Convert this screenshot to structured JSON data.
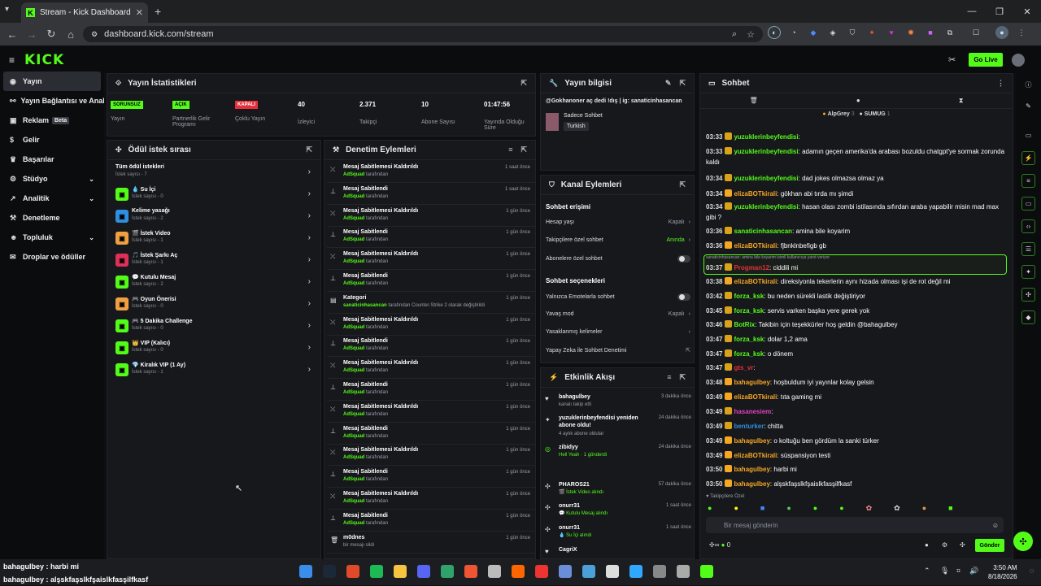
{
  "browser": {
    "tab_title": "Stream - Kick Dashboard",
    "url": "dashboard.kick.com/stream"
  },
  "header": {
    "logo": "KICK",
    "go_live": "Go Live"
  },
  "nav": [
    {
      "label": "Yayın",
      "icon": "broadcast-icon"
    },
    {
      "label": "Yayın Bağlantısı ve Anahtarı",
      "icon": "link-icon"
    },
    {
      "label": "Reklam",
      "icon": "megaphone-icon",
      "badge": "Beta"
    },
    {
      "label": "Gelir",
      "icon": "dollar-icon"
    },
    {
      "label": "Başarılar",
      "icon": "trophy-icon"
    },
    {
      "label": "Stüdyo",
      "icon": "gear-icon"
    },
    {
      "label": "Analitik",
      "icon": "chart-icon"
    },
    {
      "label": "Denetleme",
      "icon": "gavel-icon"
    },
    {
      "label": "Topluluk",
      "icon": "people-icon"
    },
    {
      "label": "Droplar ve ödüller",
      "icon": "gift-icon"
    }
  ],
  "stats": {
    "title": "Yayın İstatistikleri",
    "items": [
      {
        "badge": "SORUNSUZ",
        "label": "Yayın",
        "color": "#53fc18"
      },
      {
        "badge": "AÇIK",
        "label": "Partnerlik Gelir Programı",
        "color": "#53fc18"
      },
      {
        "badge": "KAPALI",
        "label": "Çoklu Yayın",
        "color": "#e5303c"
      },
      {
        "value": "40",
        "label": "İzleyici"
      },
      {
        "value": "2.371",
        "label": "Takipçi"
      },
      {
        "value": "10",
        "label": "Abone Sayısı"
      },
      {
        "value": "01:47:56",
        "label": "Yayında Olduğu Süre"
      }
    ]
  },
  "stream_info": {
    "title": "Yayın bilgisi",
    "stream_title": "@Gokhanoner aç dedi !dış | ig: sanaticinhasancan",
    "category": "Sadece Sohbet",
    "tag": "Turkish"
  },
  "rewards": {
    "title": "Ödül istek sırası",
    "items": [
      {
        "name": "Tüm ödül istekleri",
        "count": "İstek sayısı - 7"
      },
      {
        "name": "💧 Su İçi",
        "count": "İstek sayısı - 0",
        "color": "#53fc18"
      },
      {
        "name": "Kelime yasağı",
        "count": "İstek sayısı - 2",
        "color": "#2f8fe0"
      },
      {
        "name": "🎬 İstek Video",
        "count": "İstek sayısı - 1",
        "color": "#f0a040"
      },
      {
        "name": "🎵 İstek Şarkı Aç",
        "count": "İstek sayısı - 1",
        "color": "#e0305a"
      },
      {
        "name": "💬 Kutulu Mesaj",
        "count": "İstek sayısı - 2",
        "color": "#53fc18"
      },
      {
        "name": "🎮 Oyun Önerisi",
        "count": "İstek sayısı - 0",
        "color": "#f0a040"
      },
      {
        "name": "🎮 5 Dakika Challenge",
        "count": "İstek sayısı - 0",
        "color": "#53fc18"
      },
      {
        "name": "👑 VIP (Kalıcı)",
        "count": "İstek sayısı - 0",
        "color": "#53fc18"
      },
      {
        "name": "💎 Kiralık VIP (1 Ay)",
        "count": "İstek sayısı - 1",
        "color": "#53fc18"
      }
    ]
  },
  "modlog": {
    "title": "Denetim Eylemleri",
    "items": [
      {
        "action": "Mesaj Sabitlemesi Kaldırıldı",
        "by": "AdSquad",
        "suffix": "tarafından",
        "when": "1 saat önce",
        "icon": "unpin-icon"
      },
      {
        "action": "Mesaj Sabitlendi",
        "by": "AdSquad",
        "suffix": "tarafından",
        "when": "1 saat önce",
        "icon": "pin-icon"
      },
      {
        "action": "Mesaj Sabitlemesi Kaldırıldı",
        "by": "AdSquad",
        "suffix": "tarafından",
        "when": "1 gün önce",
        "icon": "unpin-icon"
      },
      {
        "action": "Mesaj Sabitlendi",
        "by": "AdSquad",
        "suffix": "tarafından",
        "when": "1 gün önce",
        "icon": "pin-icon"
      },
      {
        "action": "Mesaj Sabitlemesi Kaldırıldı",
        "by": "AdSquad",
        "suffix": "tarafından",
        "when": "1 gün önce",
        "icon": "unpin-icon"
      },
      {
        "action": "Mesaj Sabitlendi",
        "by": "AdSquad",
        "suffix": "tarafından",
        "when": "1 gün önce",
        "icon": "pin-icon"
      },
      {
        "action": "Kategori",
        "by": "sanaticinhasancan",
        "suffix": "tarafından Counter-Strike 2 olarak değiştirildi",
        "when": "1 gün önce",
        "icon": "category-icon"
      },
      {
        "action": "Mesaj Sabitlemesi Kaldırıldı",
        "by": "AdSquad",
        "suffix": "tarafından",
        "when": "1 gün önce",
        "icon": "unpin-icon"
      },
      {
        "action": "Mesaj Sabitlendi",
        "by": "AdSquad",
        "suffix": "tarafından",
        "when": "1 gün önce",
        "icon": "pin-icon"
      },
      {
        "action": "Mesaj Sabitlemesi Kaldırıldı",
        "by": "AdSquad",
        "suffix": "tarafından",
        "when": "1 gün önce",
        "icon": "unpin-icon"
      },
      {
        "action": "Mesaj Sabitlendi",
        "by": "AdSquad",
        "suffix": "tarafından",
        "when": "1 gün önce",
        "icon": "pin-icon"
      },
      {
        "action": "Mesaj Sabitlemesi Kaldırıldı",
        "by": "AdSquad",
        "suffix": "tarafından",
        "when": "1 gün önce",
        "icon": "unpin-icon"
      },
      {
        "action": "Mesaj Sabitlendi",
        "by": "AdSquad",
        "suffix": "tarafından",
        "when": "1 gün önce",
        "icon": "pin-icon"
      },
      {
        "action": "Mesaj Sabitlemesi Kaldırıldı",
        "by": "AdSquad",
        "suffix": "tarafından",
        "when": "1 gün önce",
        "icon": "unpin-icon"
      },
      {
        "action": "Mesaj Sabitlendi",
        "by": "AdSquad",
        "suffix": "tarafından",
        "when": "1 gün önce",
        "icon": "pin-icon"
      },
      {
        "action": "Mesaj Sabitlemesi Kaldırıldı",
        "by": "AdSquad",
        "suffix": "tarafından",
        "when": "1 gün önce",
        "icon": "unpin-icon"
      },
      {
        "action": "Mesaj Sabitlendi",
        "by": "AdSquad",
        "suffix": "tarafından",
        "when": "1 gün önce",
        "icon": "pin-icon"
      },
      {
        "action": "m0dnes",
        "by": "",
        "suffix": "bir mesajı sildi",
        "when": "1 gün önce",
        "icon": "trash-icon"
      }
    ]
  },
  "channel": {
    "title": "Kanal Eylemleri",
    "chat_access": "Sohbet erişimi",
    "age": "Hesap yaşı",
    "age_val": "Kapalı",
    "followers": "Takipçilere özel sohbet",
    "followers_val": "Anında",
    "subs": "Abonelere özel sohbet",
    "chat_opts": "Sohbet seçenekleri",
    "emotes": "Yalnızca Emotelarla sohbet",
    "slow": "Yavaş mod",
    "slow_val": "Kapalı",
    "banned": "Yasaklanmış kelimeler",
    "ai": "Yapay Zeka ile Sohbet Denetimi"
  },
  "activity": {
    "title": "Etkinlik Akışı",
    "items": [
      {
        "name": "bahagulbey",
        "desc": "kanalı takip etti",
        "when": "3 dakika önce",
        "icon": "heart-icon"
      },
      {
        "name": "yuzuklerinbeyfendisi yeniden abone oldu!",
        "desc": "4 aylık abone oldular",
        "when": "24 dakika önce",
        "icon": "star-icon"
      },
      {
        "name": "zibidyy",
        "desc": "Hell Yeah · 1 gönderdi",
        "when": "24 dakika önce",
        "icon": "kicks-icon"
      },
      {
        "name": "PHAROS21",
        "desc": "🎬 İstek Video alındı",
        "when": "57 dakika önce",
        "icon": "reward-icon"
      },
      {
        "name": "onurr31",
        "desc": "💬 Kutulu Mesaj alındı",
        "when": "1 saat önce",
        "icon": "reward-icon"
      },
      {
        "name": "onurr31",
        "desc": "💧 Su İçi alındı",
        "when": "1 saat önce",
        "icon": "reward-icon"
      },
      {
        "name": "CagriX",
        "desc": "",
        "when": "",
        "icon": "heart-icon"
      }
    ]
  },
  "chat": {
    "title": "Sohbet",
    "top_user1": "AlpGrey",
    "top_num1": "3",
    "top_user2": "SUMUG",
    "top_num2": "1",
    "messages": [
      {
        "time": "03:33",
        "user": "yuzuklerinbeyfendisi",
        "color": "#53fc18",
        "text": ""
      },
      {
        "time": "03:33",
        "user": "yuzuklerinbeyfendisi",
        "color": "#53fc18",
        "text": "adamın geçen amerika'da arabası bozuldu chatgpt'ye sormak zorunda kaldı"
      },
      {
        "time": "03:34",
        "user": "yuzuklerinbeyfendisi",
        "color": "#53fc18",
        "text": "dad jokes olmazsa olmaz ya"
      },
      {
        "time": "03:34",
        "user": "elizaBOTkirali",
        "color": "#f5a623",
        "text": "gökhan abi tırda mı şimdi"
      },
      {
        "time": "03:34",
        "user": "yuzuklerinbeyfendisi",
        "color": "#53fc18",
        "text": "hasan olası zombi istilasında sıfırdan araba yapabilir misin mad max gibi ?"
      },
      {
        "time": "03:36",
        "user": "sanaticinhasancan",
        "color": "#53fc18",
        "text": "amina bile koyarim"
      },
      {
        "time": "03:36",
        "user": "elizaBOTkirali",
        "color": "#f5a623",
        "text": "fjbnklnbefigb gb"
      },
      {
        "time": "03:37",
        "user": "Progman12",
        "color": "#e5303c",
        "text": "ciddili mi",
        "reply": "sanaticinhasancan: amina bile koyarim isimli kullanıcıya yanıt veriyor"
      },
      {
        "time": "03:38",
        "user": "elizaBOTkirali",
        "color": "#f5a623",
        "text": "direksiyonla tekerlerin aynı hizada olması işi de rot değil mi"
      },
      {
        "time": "03:42",
        "user": "forza_ksk",
        "color": "#53fc18",
        "text": "bu neden sürekli lastik değiştiriyor"
      },
      {
        "time": "03:45",
        "user": "forza_ksk",
        "color": "#53fc18",
        "text": "servis varken başka yere gerek yok"
      },
      {
        "time": "03:46",
        "user": "BotRix",
        "color": "#53fc18",
        "text": "Takibin için teşekkürler hoş geldin @bahagulbey"
      },
      {
        "time": "03:47",
        "user": "forza_ksk",
        "color": "#53fc18",
        "text": "dolar 1,2 ama"
      },
      {
        "time": "03:47",
        "user": "forza_ksk",
        "color": "#53fc18",
        "text": "o dönem"
      },
      {
        "time": "03:47",
        "user": "gts_vr",
        "color": "#e5303c",
        "text": ""
      },
      {
        "time": "03:48",
        "user": "bahagulbey",
        "color": "#f5a623",
        "text": "hoşbuldum iyi yayınlar kolay gelsin"
      },
      {
        "time": "03:49",
        "user": "elizaBOTkirali",
        "color": "#f5a623",
        "text": "tıta gaming mi"
      },
      {
        "time": "03:49",
        "user": "hasanesiem",
        "color": "#e040c0",
        "text": ""
      },
      {
        "time": "03:49",
        "user": "benturker",
        "color": "#2f8fe0",
        "text": "chitta"
      },
      {
        "time": "03:49",
        "user": "bahagulbey",
        "color": "#f5a623",
        "text": "o koltuğu ben gördüm la sanki türker"
      },
      {
        "time": "03:49",
        "user": "elizaBOTkirali",
        "color": "#f5a623",
        "text": "süspansiyon testi"
      },
      {
        "time": "03:50",
        "user": "bahagulbey",
        "color": "#f5a623",
        "text": "harbi mi"
      },
      {
        "time": "03:50",
        "user": "bahagulbey",
        "color": "#f5a623",
        "text": "alşskfaşslkfşaislkfasşilfkasf"
      }
    ],
    "followers_only": "Takipçilere Özel",
    "input_placeholder": "Bir mesaj gönderin",
    "kicks": "0",
    "send": "Gönder"
  },
  "overlay": {
    "line1": "bahagulbey : harbi mi",
    "line2": "bahagulbey : alşskfaşslkfşaislkfasşilfkasf"
  },
  "clock": {
    "time": "3:50 AM",
    "date": "8/18/2026"
  }
}
